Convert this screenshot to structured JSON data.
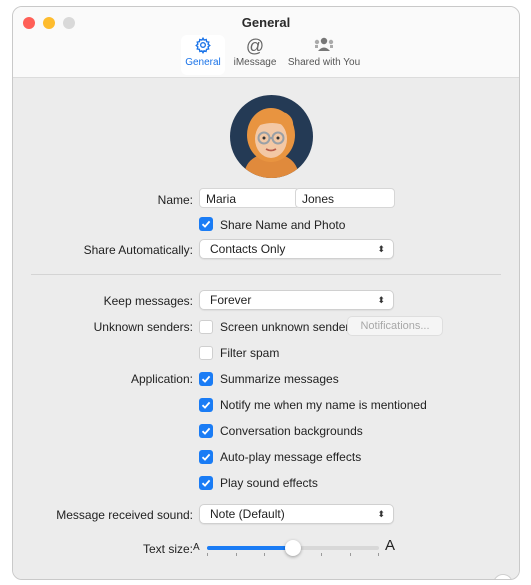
{
  "window": {
    "title": "General"
  },
  "colors": {
    "accent": "#1a7cf5",
    "close": "#ff5f57",
    "minimize": "#febc2e",
    "zoom": "#d9d9d9"
  },
  "tabs": [
    {
      "label": "General",
      "icon": "gear-icon",
      "active": true
    },
    {
      "label": "iMessage",
      "icon": "at-sign-icon",
      "active": false
    },
    {
      "label": "Shared with You",
      "icon": "shared-people-icon",
      "active": false
    }
  ],
  "profile": {
    "avatar_icon": "memoji-avatar",
    "name_label": "Name:",
    "first_name": "Maria",
    "last_name": "Jones",
    "share_name_photo": {
      "label": "Share Name and Photo",
      "checked": true
    },
    "share_auto_label": "Share Automatically:",
    "share_auto_value": "Contacts Only"
  },
  "messages": {
    "keep_label": "Keep messages:",
    "keep_value": "Forever",
    "unknown_label": "Unknown senders:",
    "screen_unknown": {
      "label": "Screen unknown senders",
      "checked": false
    },
    "notifications_button": "Notifications...",
    "filter_spam": {
      "label": "Filter spam",
      "checked": false
    }
  },
  "application": {
    "label": "Application:",
    "options": [
      {
        "label": "Summarize messages",
        "checked": true
      },
      {
        "label": "Notify me when my name is mentioned",
        "checked": true
      },
      {
        "label": "Conversation backgrounds",
        "checked": true
      },
      {
        "label": "Auto-play message effects",
        "checked": true
      },
      {
        "label": "Play sound effects",
        "checked": true
      }
    ]
  },
  "sound": {
    "label": "Message received sound:",
    "value": "Note (Default)"
  },
  "text_size": {
    "label": "Text size:",
    "small_glyph": "A",
    "large_glyph": "A",
    "level_fraction": 0.5,
    "ticks": 7
  },
  "help_label": "?"
}
